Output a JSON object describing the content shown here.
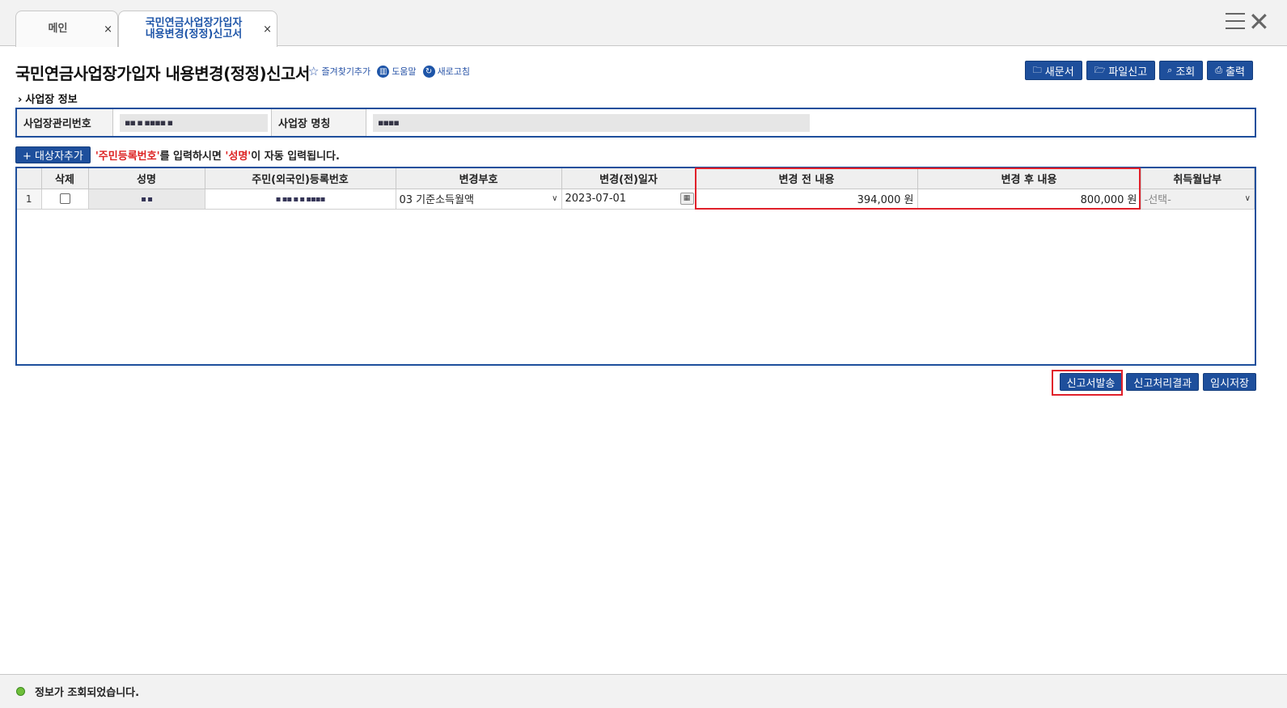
{
  "tabs": [
    {
      "label": "메인",
      "close": "×"
    },
    {
      "label_line1": "국민연금사업장가입자",
      "label_line2": "내용변경(정정)신고서",
      "close": "×"
    }
  ],
  "page": {
    "title": "국민연금사업장가입자 내용변경(정정)신고서",
    "links": {
      "favorite": "즐겨찾기추가",
      "help": "도움말",
      "refresh": "새로고침"
    }
  },
  "toolbar": {
    "new_doc": "새문서",
    "file_report": "파일신고",
    "search": "조회",
    "print": "출력"
  },
  "business": {
    "section_title": "사업장 정보",
    "mgmt_no_label": "사업장관리번호",
    "mgmt_no_value": "▪▪ ▪ ▪▪▪▪ ▪",
    "name_label": "사업장 명칭",
    "name_value": "▪▪▪▪"
  },
  "add": {
    "button": "+ 대상자추가",
    "notice_q1": "'주민등록번호'",
    "notice_mid": "를 입력하시면 ",
    "notice_q2": "'성명'",
    "notice_end": "이 자동 입력됩니다."
  },
  "grid": {
    "headers": [
      "",
      "삭제",
      "성명",
      "주민(외국인)등록번호",
      "변경부호",
      "변경(전)일자",
      "변경 전 내용",
      "변경 후 내용",
      "취득월납부"
    ],
    "rows": [
      {
        "no": "1",
        "name": "▪ ▪",
        "rrn": "▪ ▪▪ ▪ ▪   ▪▪▪▪",
        "change_code": "03 기준소득월액",
        "change_date": "2023-07-01",
        "before": "394,000 원",
        "after": "800,000 원",
        "acq_month": "-선택-"
      }
    ]
  },
  "actions": {
    "submit": "신고서발송",
    "result": "신고처리결과",
    "temp_save": "임시저장"
  },
  "status": {
    "message": "정보가 조회되었습니다."
  },
  "colors": {
    "primary": "#1e4f9c",
    "highlight": "#e0202a",
    "status_ok": "#6fbf3a"
  }
}
